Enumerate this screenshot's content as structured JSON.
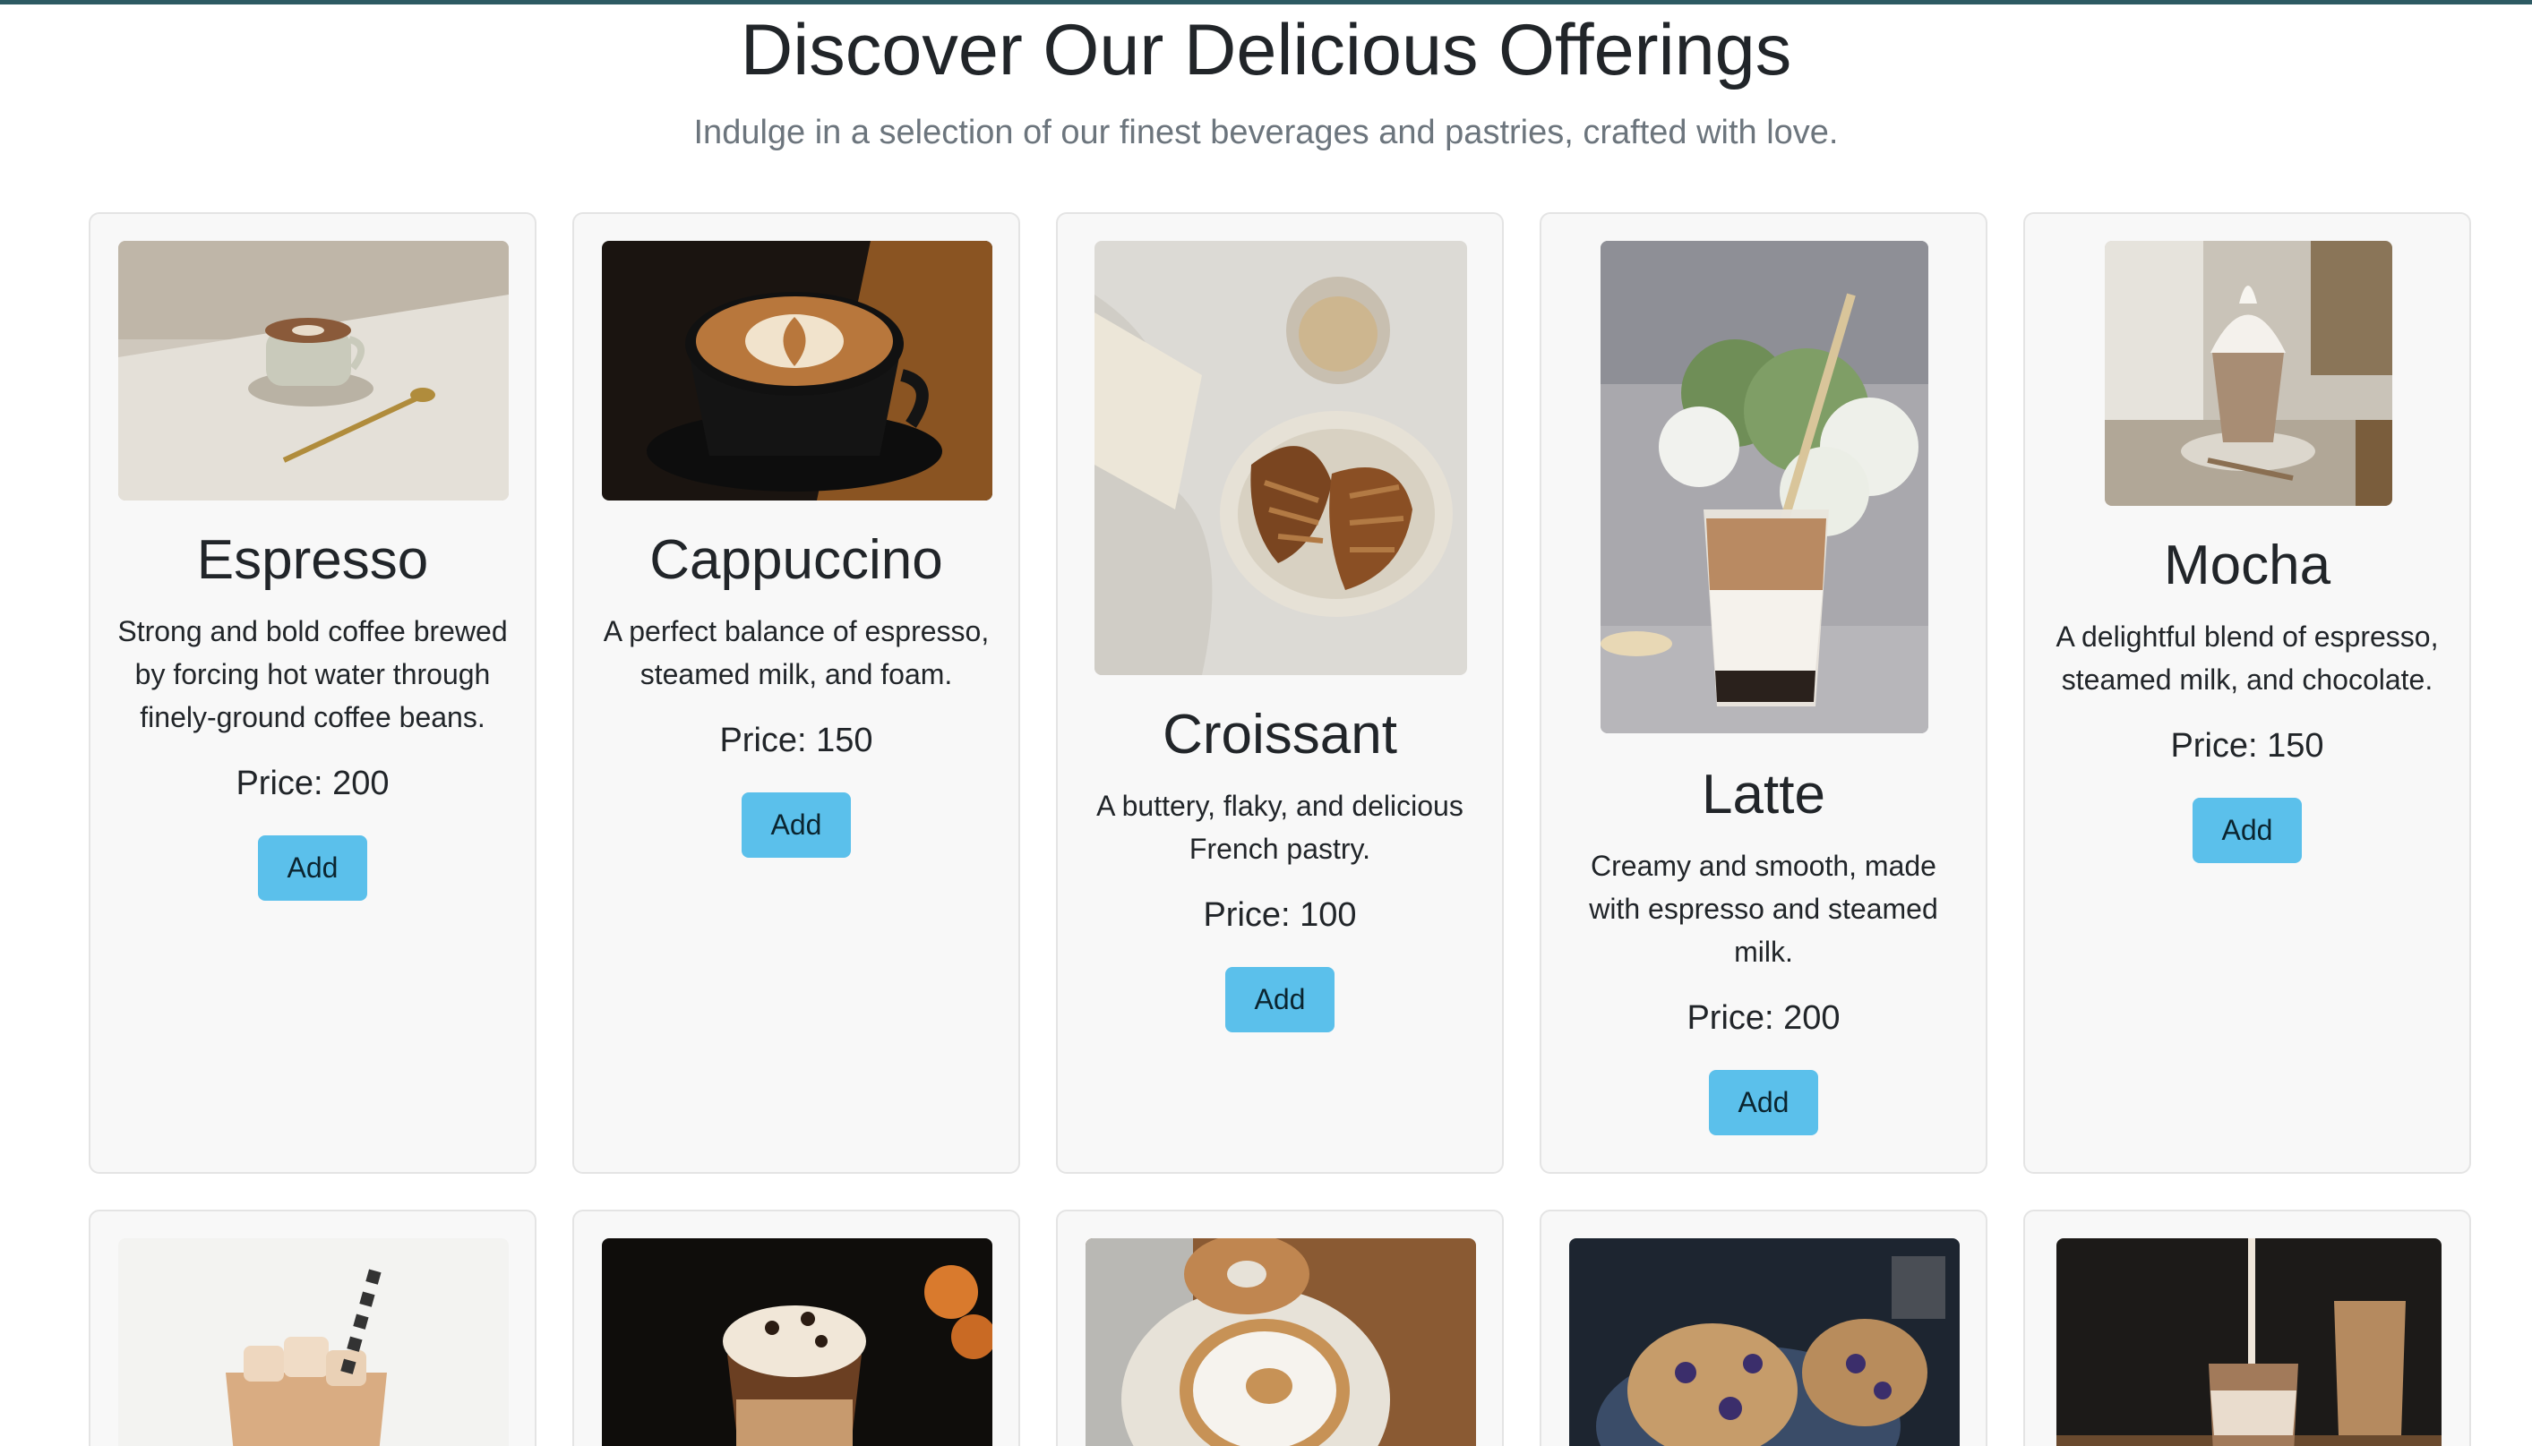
{
  "header": {
    "title": "Discover Our Delicious Offerings",
    "subtitle": "Indulge in a selection of our finest beverages and pastries, crafted with love."
  },
  "add_label": "Add",
  "products": [
    {
      "name": "Espresso",
      "description": "Strong and bold coffee brewed by forcing hot water through finely-ground coffee beans.",
      "price": "Price: 200",
      "image": "espresso-cup-photo"
    },
    {
      "name": "Cappuccino",
      "description": "A perfect balance of espresso, steamed milk, and foam.",
      "price": "Price: 150",
      "image": "cappuccino-latte-art-photo"
    },
    {
      "name": "Croissant",
      "description": "A buttery, flaky, and delicious French pastry.",
      "price": "Price: 100",
      "image": "croissant-plate-photo"
    },
    {
      "name": "Latte",
      "description": "Creamy and smooth, made with espresso and steamed milk.",
      "price": "Price: 200",
      "image": "iced-latte-glass-photo"
    },
    {
      "name": "Mocha",
      "description": "A delightful blend of espresso, steamed milk, and chocolate.",
      "price": "Price: 150",
      "image": "mocha-cup-photo"
    }
  ],
  "second_row_images": [
    "iced-coffee-illustration",
    "whipped-cream-coffee-photo",
    "bagel-cream-cheese-photo",
    "blueberry-muffins-photo",
    "iced-coffee-pour-photo"
  ],
  "colors": {
    "accent_bar": "#2d5a63",
    "button": "#5bc0eb",
    "card_bg": "#f8f8f8"
  }
}
